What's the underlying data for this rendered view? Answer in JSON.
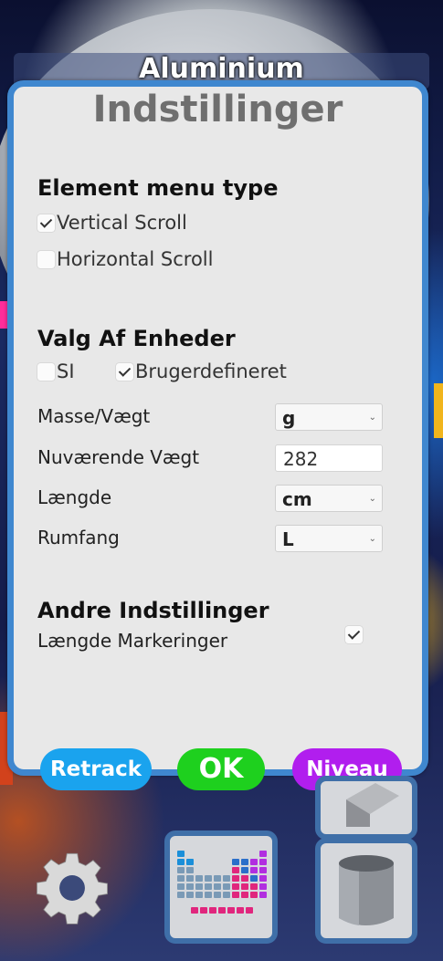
{
  "background": {
    "element_title": "Aluminium"
  },
  "settings": {
    "title": "Indstillinger",
    "element_menu": {
      "heading": "Element menu type",
      "options": [
        {
          "label": "Vertical Scroll",
          "checked": true
        },
        {
          "label": "Horizontal Scroll",
          "checked": false
        }
      ]
    },
    "units": {
      "heading": "Valg Af Enheder",
      "systems": [
        {
          "label": "SI",
          "checked": false
        },
        {
          "label": "Brugerdefineret",
          "checked": true
        }
      ],
      "rows": {
        "mass": {
          "label": "Masse/Vægt",
          "value": "g"
        },
        "current_weight": {
          "label": "Nuværende Vægt",
          "value": "282"
        },
        "length": {
          "label": "Længde",
          "value": "cm"
        },
        "volume": {
          "label": "Rumfang",
          "value": "L"
        }
      }
    },
    "other": {
      "heading": "Andre Indstillinger",
      "length_markings": {
        "label": "Længde Markeringer",
        "checked": true
      }
    }
  },
  "buttons": {
    "retrack": "Retrack",
    "ok": "OK",
    "niveau": "Niveau"
  },
  "colors": {
    "panel_border": "#3f87cf",
    "retrack": "#1aa3ee",
    "ok": "#1ed01e",
    "niveau": "#b11eee"
  },
  "toolbar_icons": [
    "gear-icon",
    "periodic-table-icon",
    "cube-icon",
    "cylinder-icon"
  ]
}
